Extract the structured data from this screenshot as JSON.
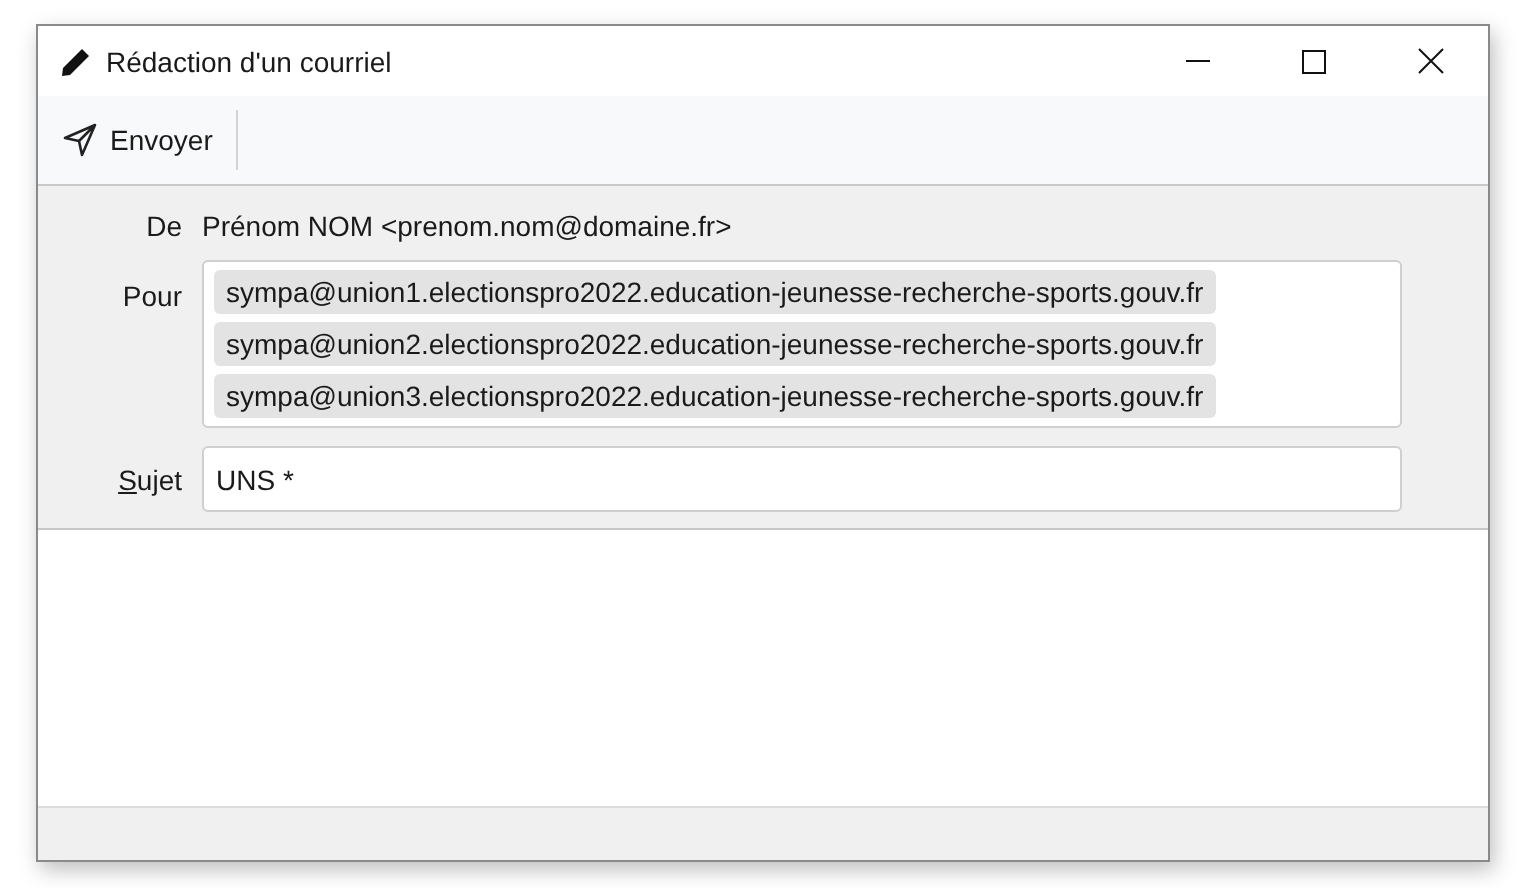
{
  "window": {
    "title": "Rédaction d'un courriel"
  },
  "toolbar": {
    "send_button": "Envoyer"
  },
  "from": {
    "label": "De",
    "value": "Prénom NOM <prenom.nom@domaine.fr>"
  },
  "to": {
    "label": "Pour",
    "recipients": [
      "sympa@union1.electionspro2022.education-jeunesse-recherche-sports.gouv.fr",
      "sympa@union2.electionspro2022.education-jeunesse-recherche-sports.gouv.fr",
      "sympa@union3.electionspro2022.education-jeunesse-recherche-sports.gouv.fr"
    ]
  },
  "subject": {
    "label": "Sujet",
    "mnemonic": true,
    "value": "UNS *"
  }
}
